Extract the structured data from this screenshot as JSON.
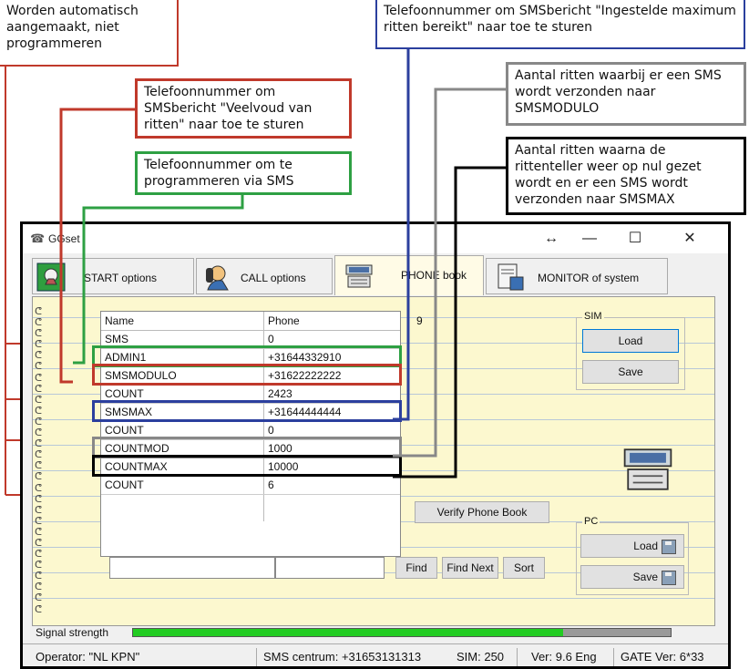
{
  "callouts": {
    "auto": "Worden automatisch aangemaakt, niet programmeren",
    "max_phone": "Telefoonnummer om SMSbericht \"Ingestelde maximum  ritten bereikt\" naar toe te sturen",
    "modulo_count": "Aantal ritten waarbij er een SMS wordt verzonden naar SMSMODULO",
    "modulo_phone": "Telefoonnummer om SMSbericht \"Veelvoud van ritten\" naar toe te sturen",
    "reset_count": "Aantal ritten waarna de rittenteller weer op nul gezet wordt en er een SMS wordt verzonden naar SMSMAX",
    "admin_phone": "Telefoonnummer om te programmeren via SMS"
  },
  "colors": {
    "red": "#c0392b",
    "green": "#2ea043",
    "blue": "#2b3f9e",
    "gray": "#888888",
    "black": "#000000",
    "signal": "#22cc22"
  },
  "window": {
    "title": "GGset",
    "controls": {
      "resize": "↔",
      "minimize": "—",
      "maximize": "☐",
      "close": "✕"
    }
  },
  "tabs": [
    {
      "label": "START options",
      "icon": "start-icon"
    },
    {
      "label": "CALL options",
      "icon": "phone-call-icon"
    },
    {
      "label": "PHONE book",
      "icon": "phonebook-icon"
    },
    {
      "label": "MONITOR of system",
      "icon": "monitor-icon"
    }
  ],
  "phonebook": {
    "headers": {
      "name": "Name",
      "phone": "Phone"
    },
    "count_indicator": "9",
    "rows": [
      {
        "name": "SMS",
        "phone": "0"
      },
      {
        "name": "ADMIN1",
        "phone": "+31644332910"
      },
      {
        "name": "SMSMODULO",
        "phone": "+31622222222"
      },
      {
        "name": "COUNT",
        "phone": "2423"
      },
      {
        "name": "SMSMAX",
        "phone": "+31644444444"
      },
      {
        "name": "COUNT",
        "phone": "0"
      },
      {
        "name": "COUNTMOD",
        "phone": "1000"
      },
      {
        "name": "COUNTMAX",
        "phone": "10000"
      },
      {
        "name": "COUNT",
        "phone": "6"
      }
    ]
  },
  "sim": {
    "title": "SIM",
    "load": "Load",
    "save": "Save"
  },
  "pc": {
    "title": "PC",
    "load": "Load",
    "save": "Save"
  },
  "verify_button": "Verify Phone Book",
  "search": {
    "value": "",
    "value2": "",
    "find": "Find",
    "find_next": "Find Next",
    "sort": "Sort"
  },
  "signal": {
    "label": "Signal strength",
    "level": 0.8
  },
  "status": {
    "operator": "Operator: \"NL KPN\"",
    "sms_centrum": "SMS centrum: +31653131313",
    "sim": "SIM: 250",
    "ver": "Ver: 9.6  Eng",
    "gate": "GATE Ver: 6*33"
  }
}
